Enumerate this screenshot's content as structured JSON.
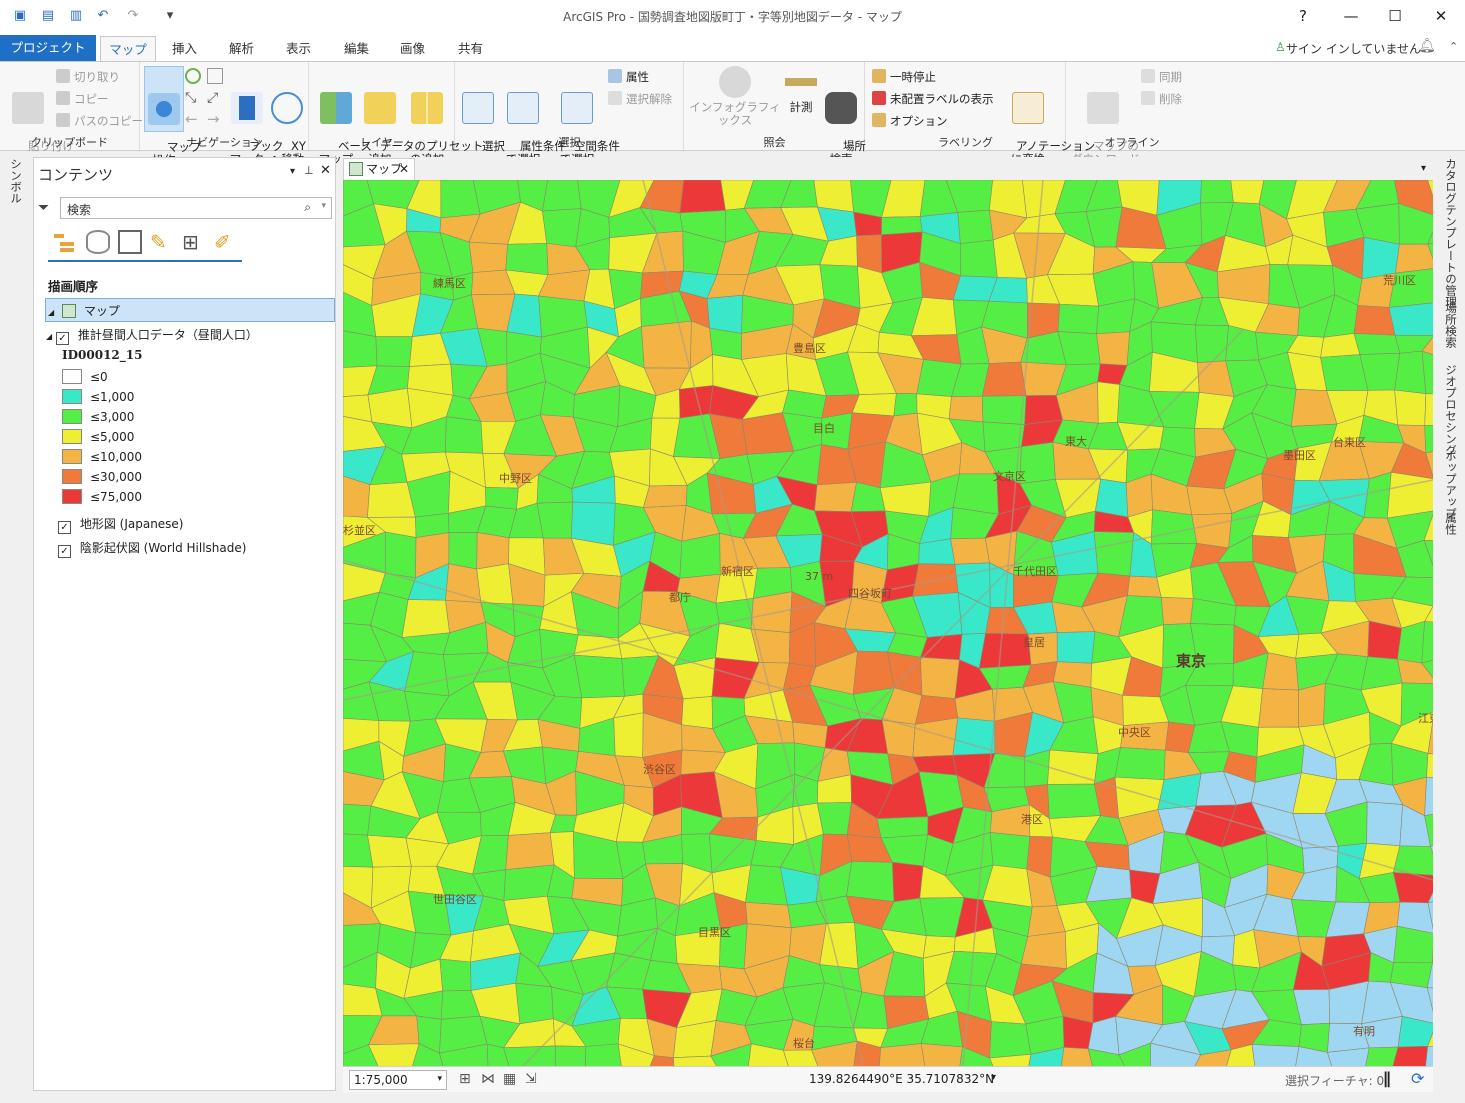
{
  "window": {
    "title": "ArcGIS Pro - 国勢調査地図版町丁・字等別地図データ - マップ",
    "help": "?"
  },
  "tabs": [
    "プロジェクト",
    "マップ",
    "挿入",
    "解析",
    "表示",
    "編集",
    "画像",
    "共有"
  ],
  "signin": "サイン インしていません",
  "ribbon": {
    "clipboard": {
      "label": "クリップボード",
      "paste": "貼り付け",
      "cut": "切り取り",
      "copy": "コピー",
      "copy_path": "パスのコピー"
    },
    "navigation": {
      "label": "ナビゲーション",
      "explore": "マップ\n操作",
      "bookmark": "ブック\nマーク",
      "goto_xy": "XY\nへ移動"
    },
    "layer": {
      "label": "レイヤー",
      "basemap": "ベース\nマップ",
      "add_data": "データの\n追加",
      "add_preset": "プリセット\nの追加"
    },
    "selection": {
      "label": "選択",
      "select": "選択",
      "by_attr": "属性条件\nで選択",
      "by_loc": "空間条件\nで選択",
      "attributes": "属性",
      "clear": "選択解除"
    },
    "inquiry": {
      "label": "照会",
      "infographics": "インフォグラフィックス",
      "measure": "計測",
      "locate": "場所\n検索"
    },
    "labeling": {
      "label": "ラベリング",
      "pause": "一時停止",
      "unplaced": "未配置ラベルの表示",
      "options": "オプション",
      "convert": "アノテーション\nに変換"
    },
    "offline": {
      "label": "オフライン",
      "download": "マップの\nダウンロード",
      "sync": "同期",
      "remove": "削除"
    }
  },
  "left_strip": {
    "symbol_tab": "シンボル"
  },
  "right_strip": {
    "tabs": [
      "カタログ",
      "テンプレートの管理",
      "場所検索",
      "ジオプロセシング",
      "ポップアップ",
      "属性"
    ]
  },
  "contents": {
    "title": "コンテンツ",
    "search_placeholder": "検索",
    "draw_order": "描画順序",
    "map_item": "マップ",
    "layer1": "推計昼間人口データ（昼間人口）",
    "field": "ID00012_15",
    "classes": [
      {
        "label": "≤0",
        "color": "#ffffff"
      },
      {
        "label": "≤1,000",
        "color": "#38e8c8"
      },
      {
        "label": "≤3,000",
        "color": "#55ee44"
      },
      {
        "label": "≤5,000",
        "color": "#eeee33"
      },
      {
        "label": "≤10,000",
        "color": "#f4b444"
      },
      {
        "label": "≤30,000",
        "color": "#ef7a3a"
      },
      {
        "label": "≤75,000",
        "color": "#ec3838"
      }
    ],
    "layer2": "地形図 (Japanese)",
    "layer3": "陰影起伏図 (World Hillshade)"
  },
  "map_tab": "マップ",
  "map_labels": [
    "練馬区",
    "豊島区",
    "荒川区",
    "中野区",
    "文京区",
    "台東区",
    "墨田区",
    "新宿区",
    "千代田区",
    "四谷坂町",
    "東京",
    "杉並区",
    "渋谷区",
    "中央区",
    "江東区",
    "港区",
    "世田谷区",
    "目黒区",
    "都庁",
    "目白",
    "皇居",
    "東大",
    "桜台",
    "五反田",
    "有明",
    "6 m",
    "37 m"
  ],
  "status": {
    "scale": "1:75,000",
    "coords": "139.8264490°E 35.7107832°N",
    "selected": "選択フィーチャ: 0"
  }
}
